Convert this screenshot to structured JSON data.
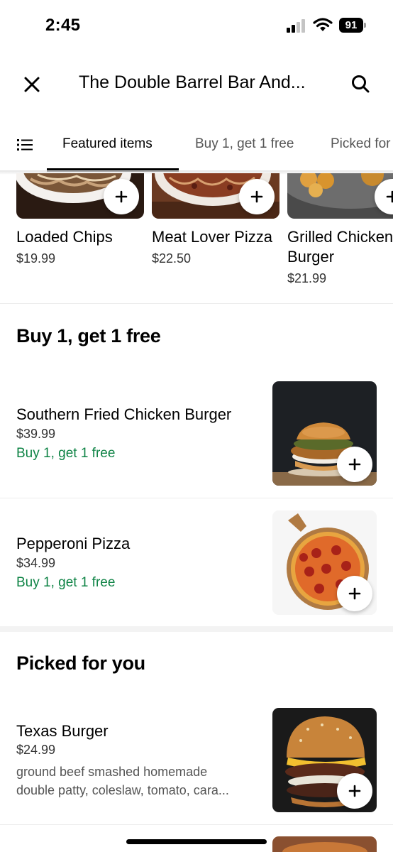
{
  "status_bar": {
    "time": "2:45",
    "battery": "91"
  },
  "header": {
    "title": "The Double Barrel Bar And...",
    "close_icon": "close-icon",
    "search_icon": "search-icon"
  },
  "tabs": [
    {
      "label": "Featured items",
      "active": true
    },
    {
      "label": "Buy 1, get 1 free",
      "active": false
    },
    {
      "label": "Picked for you",
      "active": false
    }
  ],
  "featured": [
    {
      "name": "Loaded Chips",
      "price": "$19.99"
    },
    {
      "name": "Meat Lover Pizza",
      "price": "$22.50"
    },
    {
      "name_line1": "Grilled Chicken",
      "name_line2": "Burger",
      "price": "$21.99"
    }
  ],
  "sections": {
    "bogo": {
      "title": "Buy 1, get 1 free",
      "items": [
        {
          "name": "Southern Fried Chicken Burger",
          "price": "$39.99",
          "promo": "Buy 1, get 1 free"
        },
        {
          "name": "Pepperoni Pizza",
          "price": "$34.99",
          "promo": "Buy 1, get 1 free"
        }
      ]
    },
    "picked": {
      "title": "Picked for you",
      "items": [
        {
          "name": "Texas  Burger",
          "price": "$24.99",
          "description_line1": "ground beef smashed homemade",
          "description_line2": "double patty, coleslaw, tomato, cara..."
        }
      ]
    }
  },
  "colors": {
    "promo_green": "#0e8345",
    "text_primary": "#000000",
    "text_secondary": "#545454"
  }
}
